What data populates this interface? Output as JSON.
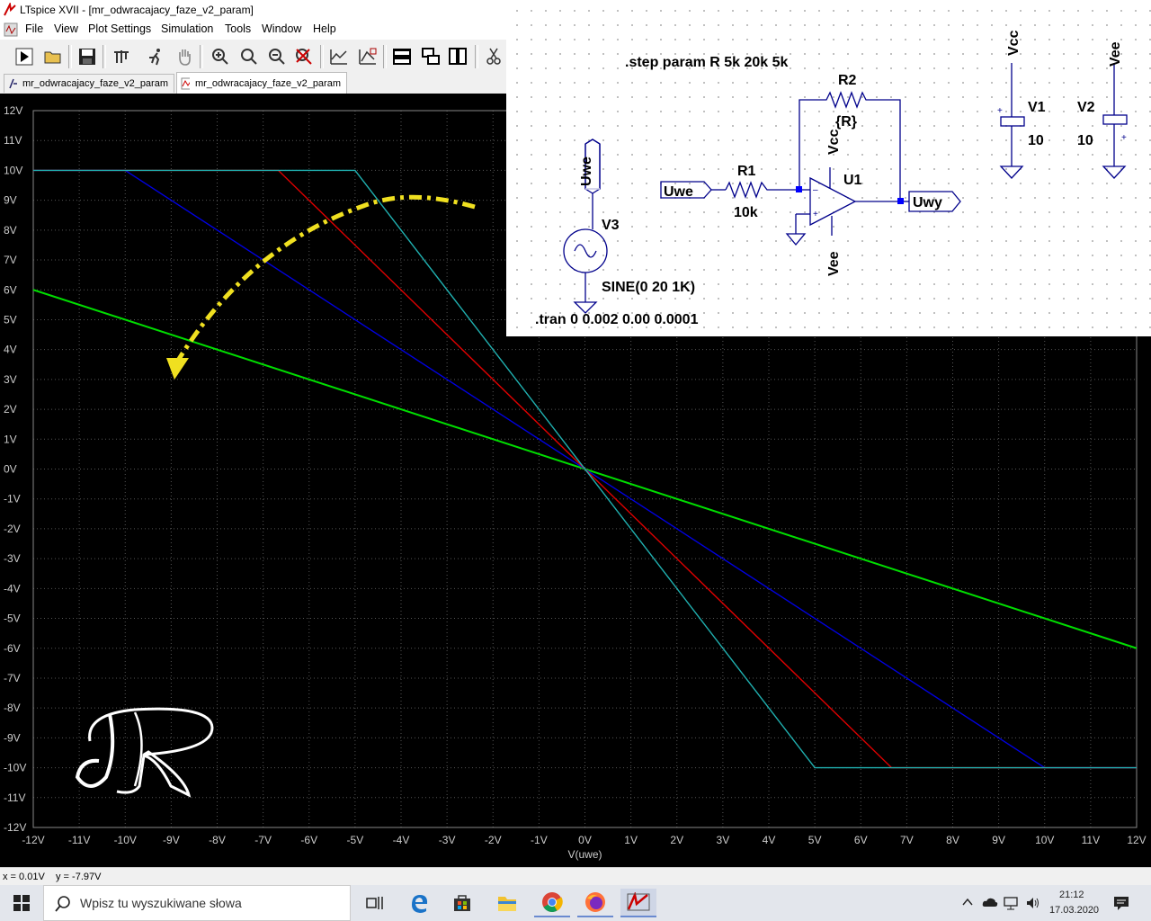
{
  "window": {
    "title": "LTspice XVII - [mr_odwracajacy_faze_v2_param]"
  },
  "menu": [
    "File",
    "View",
    "Plot Settings",
    "Simulation",
    "Tools",
    "Window",
    "Help"
  ],
  "toolbar_icons": [
    "run-icon",
    "open-icon",
    "save-icon",
    "control-panel-icon",
    "halt-icon",
    "pan-icon",
    "zoom-in-icon",
    "zoom-area-icon",
    "zoom-out-icon",
    "zoom-cancel-icon",
    "autorange-icon",
    "plot-settings-icon",
    "tile-horizontal-icon",
    "cascade-icon",
    "tile-vertical-icon",
    "cut-icon"
  ],
  "tabs": [
    {
      "label": "mr_odwracajacy_faze_v2_param",
      "icon": "schematic-icon",
      "active": false
    },
    {
      "label": "mr_odwracajacy_faze_v2_param",
      "icon": "waveform-icon",
      "active": true
    }
  ],
  "chart_data": {
    "type": "line",
    "xlabel": "V(uwe)",
    "xlim": [
      -12,
      12
    ],
    "ylim": [
      -12,
      12
    ],
    "xticks": [
      "-12V",
      "-11V",
      "-10V",
      "-9V",
      "-8V",
      "-7V",
      "-6V",
      "-5V",
      "-4V",
      "-3V",
      "-2V",
      "-1V",
      "0V",
      "1V",
      "2V",
      "3V",
      "4V",
      "5V",
      "6V",
      "7V",
      "8V",
      "9V",
      "10V",
      "11V",
      "12V"
    ],
    "yticks": [
      "12V",
      "11V",
      "10V",
      "9V",
      "8V",
      "7V",
      "6V",
      "5V",
      "4V",
      "3V",
      "2V",
      "1V",
      "0V",
      "-1V",
      "-2V",
      "-3V",
      "-4V",
      "-5V",
      "-6V",
      "-7V",
      "-8V",
      "-9V",
      "-10V",
      "-11V",
      "-12V"
    ],
    "grid": true,
    "background": "#000000",
    "series": [
      {
        "color": "#00dd00",
        "x": [
          -12,
          12
        ],
        "y": [
          6,
          -6
        ]
      },
      {
        "color": "#0000e0",
        "x": [
          -12,
          -10,
          10,
          12
        ],
        "y": [
          10,
          10,
          -10,
          -10
        ]
      },
      {
        "color": "#e00000",
        "x": [
          -12,
          -6.67,
          6.67,
          12
        ],
        "y": [
          10,
          10,
          -10,
          -10
        ]
      },
      {
        "color": "#20b0b0",
        "x": [
          -12,
          -5,
          5,
          12
        ],
        "y": [
          10,
          10,
          -10,
          -10
        ]
      }
    ]
  },
  "schematic": {
    "step": ".step param R 5k 20k 5k",
    "tran": ".tran 0 0.002 0.00 0.0001",
    "source": {
      "name": "V3",
      "value": "SINE(0 20 1K)",
      "net": "Uwe"
    },
    "r1": {
      "name": "R1",
      "value": "10k"
    },
    "r2": {
      "name": "R2",
      "value": "{R}"
    },
    "opamp": {
      "name": "U1",
      "vcc": "Vcc",
      "vee": "Vee"
    },
    "input_label": "Uwe",
    "output_label": "Uwy",
    "v1": {
      "name": "V1",
      "value": "10",
      "net": "Vcc"
    },
    "v2": {
      "name": "V2",
      "value": "10",
      "net": "Vee"
    },
    "plus": "+"
  },
  "status": {
    "x": "x = 0.01V",
    "y": "y = -7.97V"
  },
  "taskbar": {
    "search_placeholder": "Wpisz tu wyszukiwane słowa",
    "time": "21:12",
    "date": "17.03.2020"
  },
  "colors": {
    "arrow": "#f0e020",
    "grid": "#555555",
    "wire": "#0000a0"
  }
}
